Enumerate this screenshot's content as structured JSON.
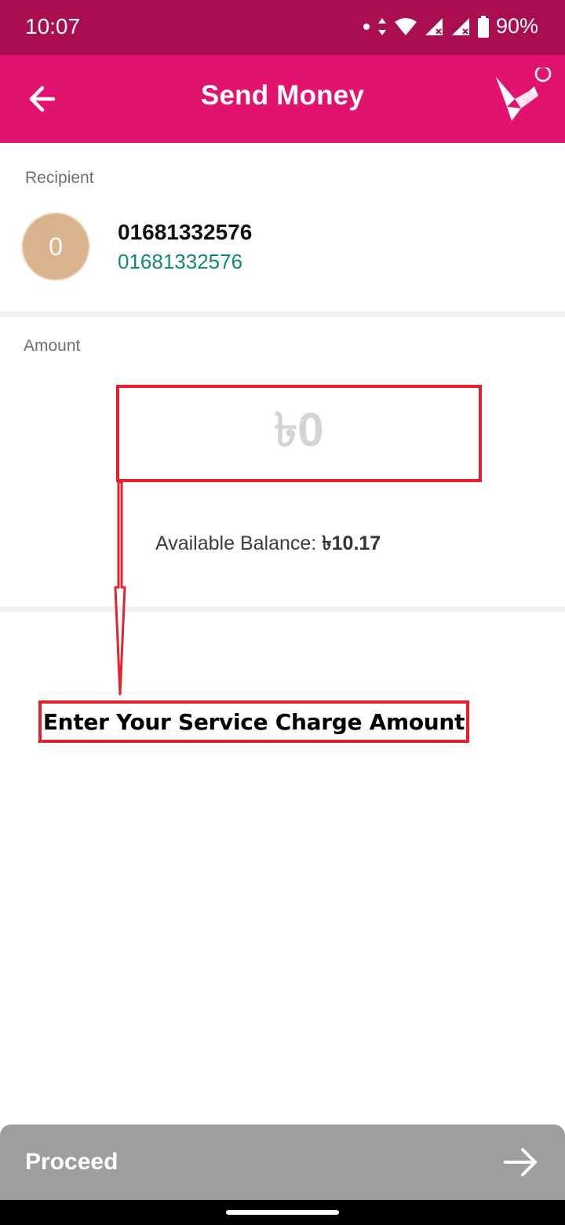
{
  "status_bar": {
    "time": "10:07",
    "battery": "90%",
    "icons": [
      "notification-dot-icon",
      "data-arrows-icon",
      "wifi-icon",
      "signal-icon",
      "signal-icon",
      "battery-icon"
    ]
  },
  "app_bar": {
    "title": "Send Money",
    "back_icon": "arrow-left-icon",
    "logo_icon": "origami-bird-logo"
  },
  "recipient": {
    "section_label": "Recipient",
    "avatar_initial": "0",
    "name": "01681332576",
    "number": "01681332576"
  },
  "amount": {
    "section_label": "Amount",
    "value": "৳0",
    "balance_label": "Available Balance: ",
    "balance_value": "৳10.17"
  },
  "annotation": {
    "text": "Enter Your Service Charge Amount",
    "color": "#e2222c"
  },
  "footer": {
    "proceed_label": "Proceed",
    "proceed_icon": "arrow-right-icon"
  },
  "colors": {
    "status_bar": "#a90f50",
    "app_bar": "#e2136e",
    "number_green": "#0f8a6c",
    "proceed_disabled": "#9e9e9e"
  }
}
